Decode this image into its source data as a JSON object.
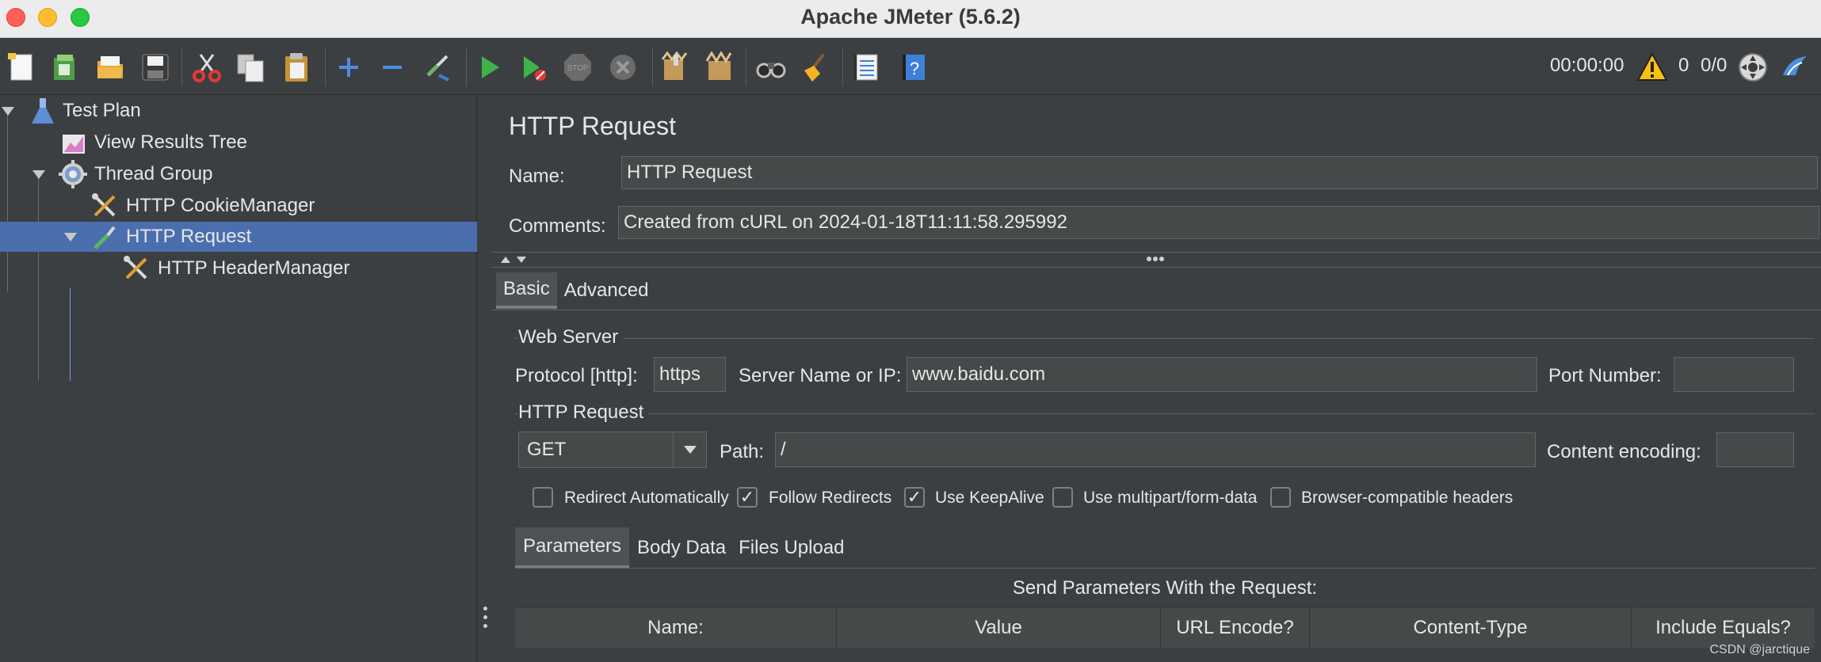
{
  "window": {
    "title": "Apache JMeter (5.6.2)"
  },
  "toolbar": {
    "icons": [
      "new-icon",
      "templates-icon",
      "open-icon",
      "save-icon",
      "cut-icon",
      "copy-icon",
      "paste-icon",
      "expand-icon",
      "collapse-icon",
      "toggle-icon",
      "start-icon",
      "start-no-pauses-icon",
      "stop-icon",
      "shutdown-icon",
      "clear-icon",
      "clear-all-icon",
      "search-icon",
      "reset-search-icon",
      "function-helper-icon",
      "help-icon"
    ],
    "elapsed_time": "00:00:00",
    "warning_count": "0",
    "threads": "0/0"
  },
  "tree": {
    "nodes": [
      {
        "label": "Test Plan",
        "icon": "flask-icon"
      },
      {
        "label": "View Results Tree",
        "icon": "graph-icon"
      },
      {
        "label": "Thread Group",
        "icon": "gear-icon"
      },
      {
        "label": "HTTP CookieManager",
        "icon": "tools-icon"
      },
      {
        "label": "HTTP Request",
        "icon": "pipette-icon",
        "selected": true
      },
      {
        "label": "HTTP HeaderManager",
        "icon": "tools-icon"
      }
    ]
  },
  "panel": {
    "title": "HTTP Request",
    "name_label": "Name:",
    "name_value": "HTTP Request",
    "comments_label": "Comments:",
    "comments_value": "Created from cURL on 2024-01-18T11:11:58.295992",
    "tabs": [
      "Basic",
      "Advanced"
    ],
    "active_tab": "Basic",
    "web_server": {
      "section": "Web Server",
      "protocol_label": "Protocol [http]:",
      "protocol_value": "https",
      "server_label": "Server Name or IP:",
      "server_value": "www.baidu.com",
      "port_label": "Port Number:",
      "port_value": ""
    },
    "http_request": {
      "section": "HTTP Request",
      "method": "GET",
      "path_label": "Path:",
      "path_value": "/",
      "encoding_label": "Content encoding:",
      "encoding_value": ""
    },
    "options": [
      {
        "label": "Redirect Automatically",
        "checked": false
      },
      {
        "label": "Follow Redirects",
        "checked": true
      },
      {
        "label": "Use KeepAlive",
        "checked": true
      },
      {
        "label": "Use multipart/form-data",
        "checked": false
      },
      {
        "label": "Browser-compatible headers",
        "checked": false
      }
    ],
    "sub_tabs": [
      "Parameters",
      "Body Data",
      "Files Upload"
    ],
    "active_sub_tab": "Parameters",
    "params_caption": "Send Parameters With the Request:",
    "columns": [
      "Name:",
      "Value",
      "URL Encode?",
      "Content-Type",
      "Include Equals?"
    ]
  },
  "watermark": "CSDN @jarctique",
  "colors": {
    "selection": "#4b6eaf",
    "background": "#3c3f41",
    "field": "#45494a"
  }
}
